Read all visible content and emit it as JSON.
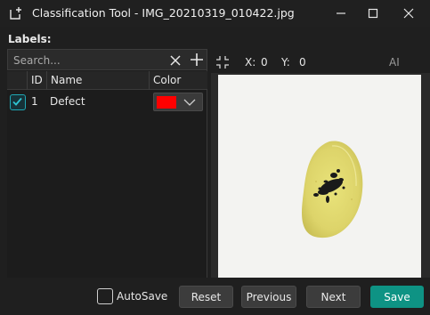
{
  "window": {
    "title": "Classification Tool - IMG_20210319_010422.jpg",
    "app_icon": "add-label-icon",
    "controls": [
      "minimize-icon",
      "maximize-icon",
      "close-icon"
    ]
  },
  "labels_panel": {
    "heading": "Labels:",
    "search": {
      "placeholder": "Search...",
      "value": ""
    },
    "clear_icon": "close-icon",
    "add_icon": "plus-icon",
    "columns": {
      "id": "ID",
      "name": "Name",
      "color": "Color"
    },
    "rows": [
      {
        "checked": true,
        "id": "1",
        "name": "Defect",
        "color": "#ff0000"
      }
    ]
  },
  "viewer": {
    "fit_icon": "fit-to-window-icon",
    "x_label": "X:",
    "x_value": "0",
    "y_label": "Y:",
    "y_value": "0",
    "ai_label": "AI",
    "image_description": "potato chip with dark spots"
  },
  "footer": {
    "autosave_label": "AutoSave",
    "autosave_checked": false,
    "reset_label": "Reset",
    "previous_label": "Previous",
    "next_label": "Next",
    "save_label": "Save"
  },
  "colors": {
    "accent": "#0e9384",
    "checkbox": "#1fa7b4",
    "background": "#1f1f1f"
  }
}
